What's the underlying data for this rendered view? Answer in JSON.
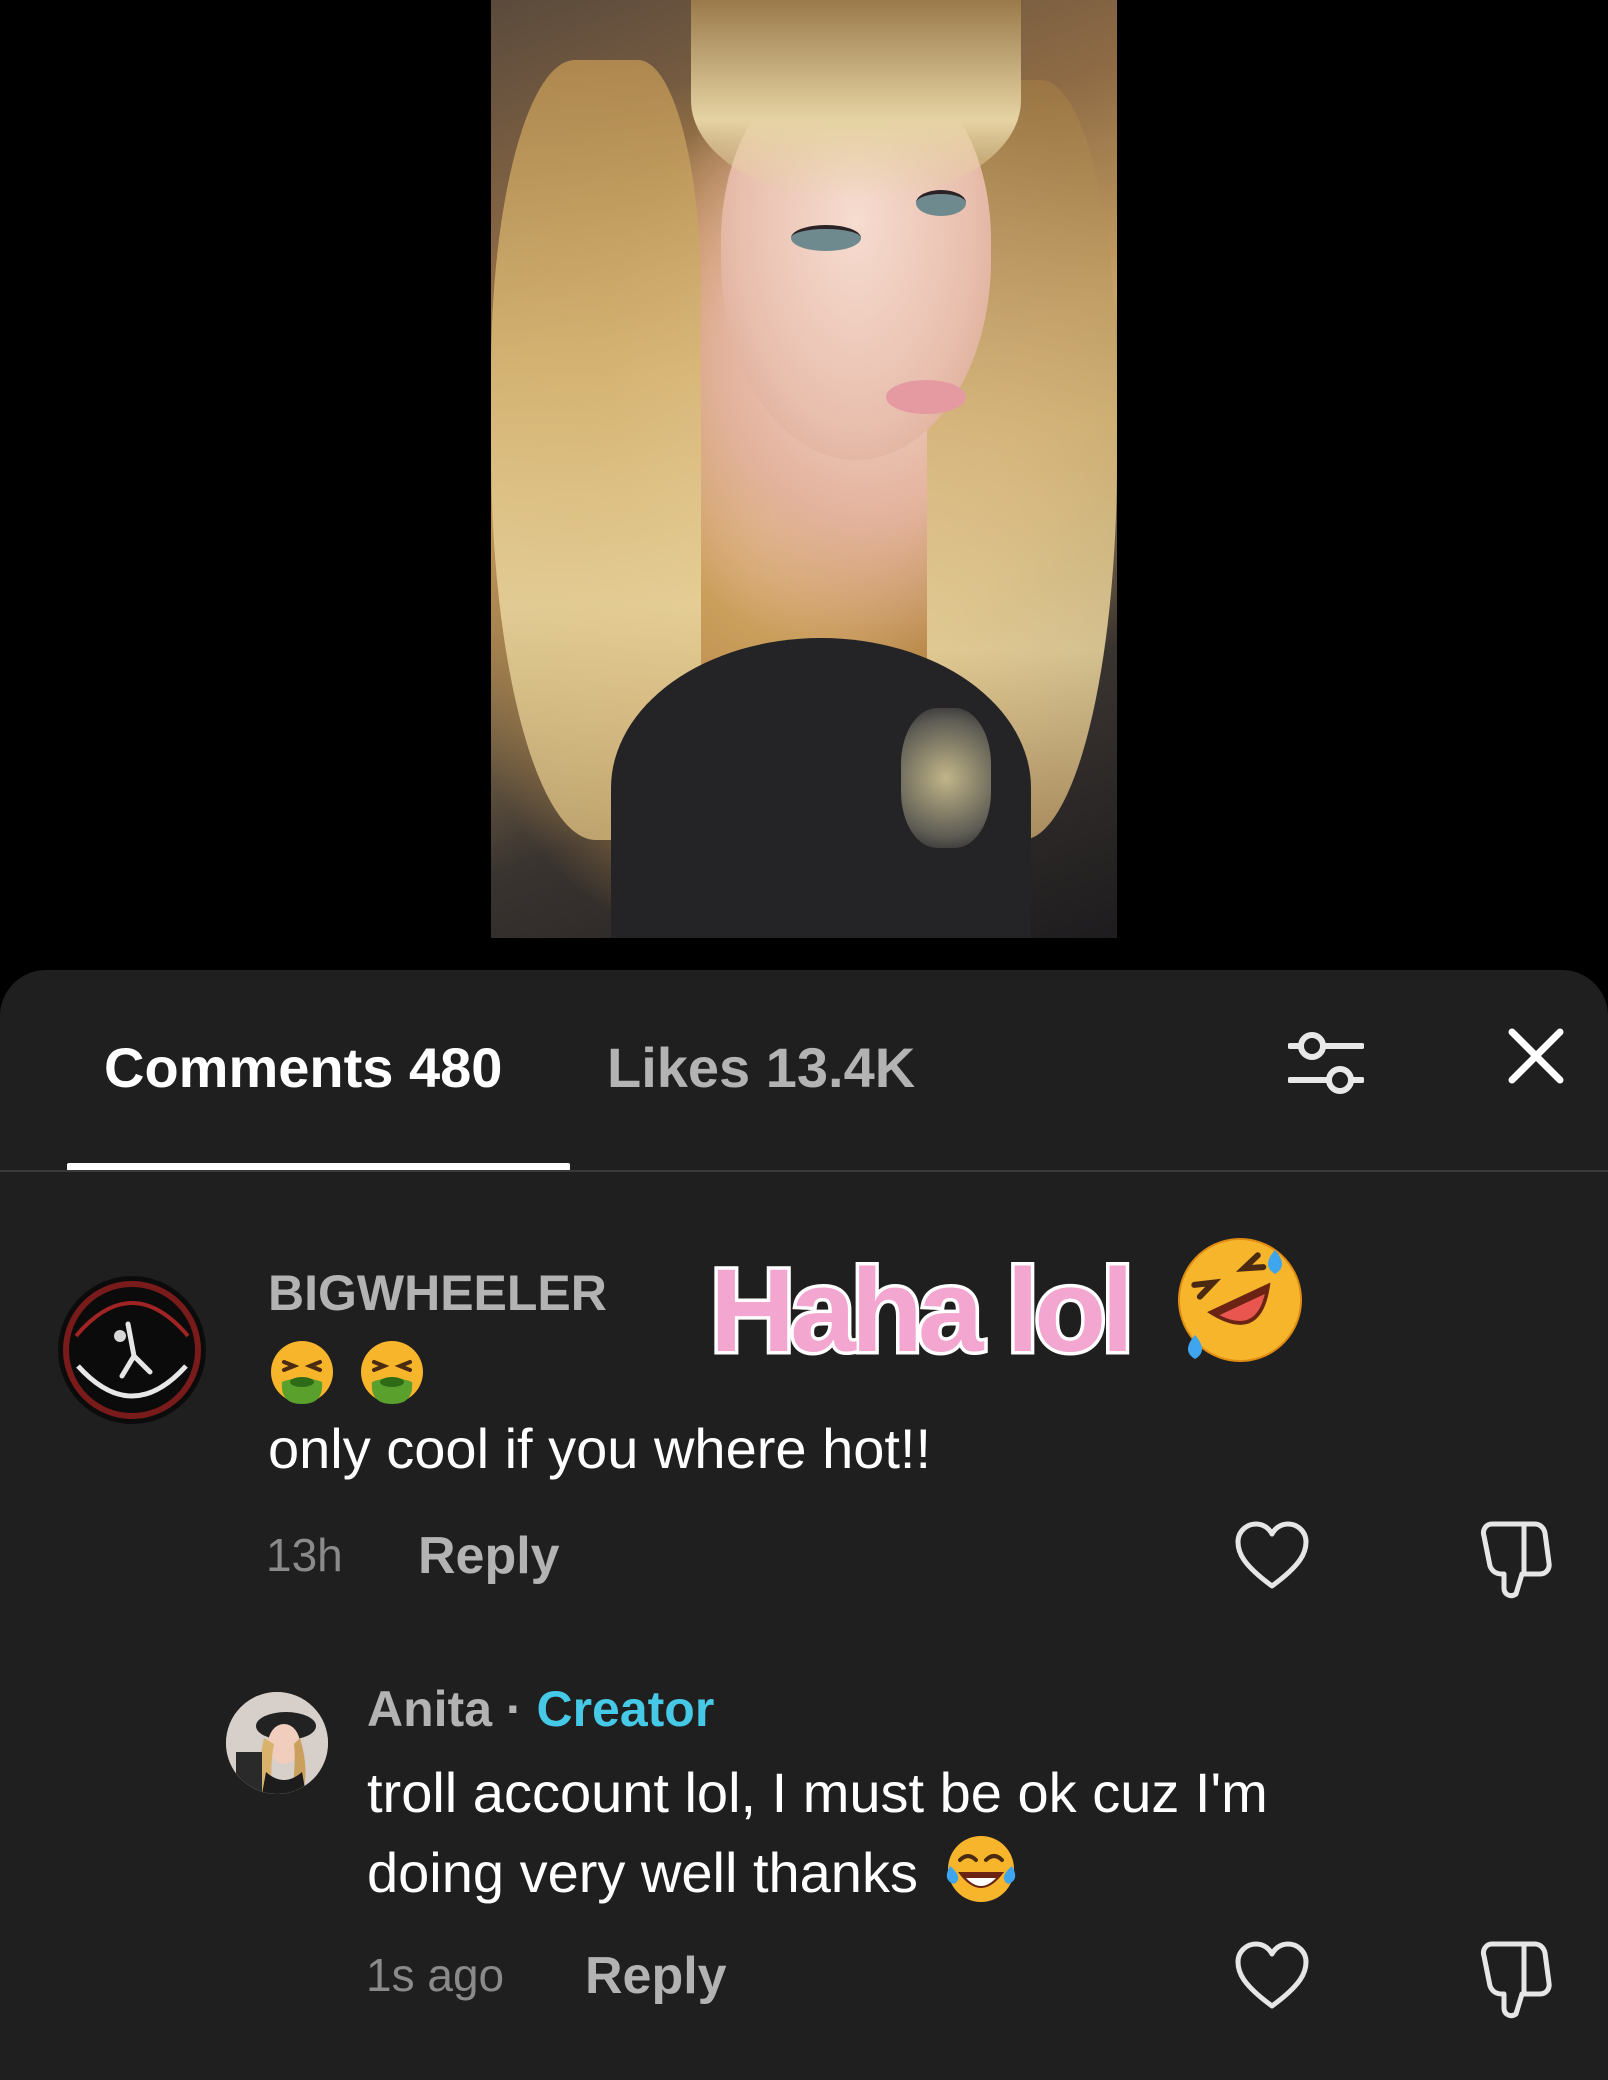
{
  "video": {
    "description_icon": "video-frame"
  },
  "tabs": {
    "comments_label": "Comments 480",
    "likes_label": "Likes 13.4K"
  },
  "toolbar": {
    "filter_icon": "sliders-icon",
    "close_icon": "close-icon"
  },
  "overlay": {
    "caption": "Haha lol",
    "emoji_icon": "rolling-on-floor-laughing-emoji"
  },
  "comments": [
    {
      "username": "BIGWHEELER",
      "emoji_line_icons": [
        "face-vomiting-emoji",
        "face-vomiting-emoji"
      ],
      "text": "only cool if you where hot!!",
      "time": "13h",
      "reply_label": "Reply"
    },
    {
      "username": "Anita",
      "separator": "·",
      "badge": "Creator",
      "text_line1": "troll account lol, I must be ok cuz I'm",
      "text_line2": "doing very well thanks",
      "trailing_emoji_icon": "face-with-tears-of-joy-emoji",
      "time": "1s ago",
      "reply_label": "Reply"
    }
  ],
  "colors": {
    "sheet_bg": "#1f1f1f",
    "creator_badge": "#46c9e6",
    "overlay_text": "#f3a6cf"
  }
}
